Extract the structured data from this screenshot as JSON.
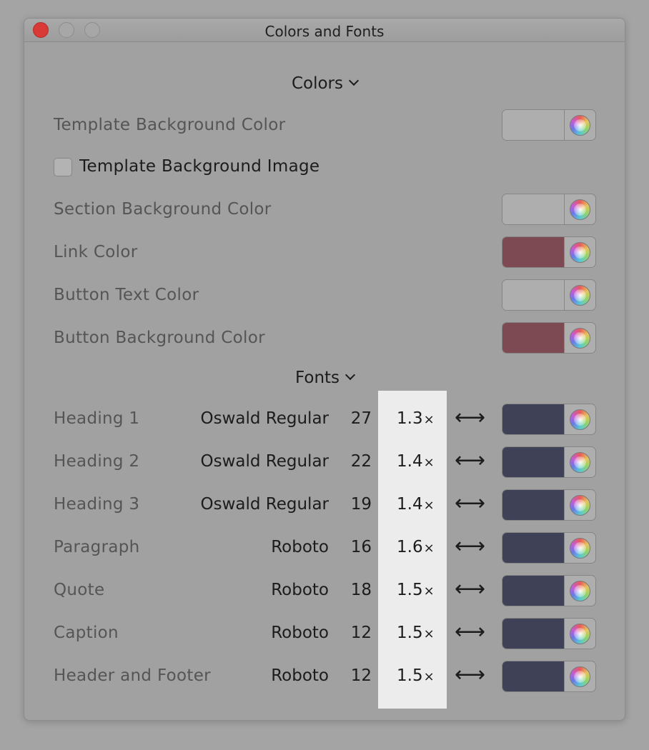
{
  "window": {
    "title": "Colors and Fonts"
  },
  "colors": {
    "header": "Colors",
    "rows": [
      {
        "label": "Template Background Color",
        "swatch": "#aeaeae"
      },
      {
        "label": "Section Background Color",
        "swatch": "#aeaeae"
      },
      {
        "label": "Link Color",
        "swatch": "#7d4953"
      },
      {
        "label": "Button Text Color",
        "swatch": "#aeaeae"
      },
      {
        "label": "Button Background Color",
        "swatch": "#7d4953"
      }
    ],
    "checkbox": {
      "label": "Template Background Image",
      "checked": false
    }
  },
  "fonts": {
    "header": "Fonts",
    "link_symbol": "⟷",
    "rows": [
      {
        "label": "Heading 1",
        "font": "Oswald Regular",
        "size": "27",
        "line_height": "1.3",
        "swatch": "#3f4157"
      },
      {
        "label": "Heading 2",
        "font": "Oswald Regular",
        "size": "22",
        "line_height": "1.4",
        "swatch": "#3f4157"
      },
      {
        "label": "Heading 3",
        "font": "Oswald Regular",
        "size": "19",
        "line_height": "1.4",
        "swatch": "#3f4157"
      },
      {
        "label": "Paragraph",
        "font": "Roboto",
        "size": "16",
        "line_height": "1.6",
        "swatch": "#3f4157"
      },
      {
        "label": "Quote",
        "font": "Roboto",
        "size": "18",
        "line_height": "1.5",
        "swatch": "#3f4157"
      },
      {
        "label": "Caption",
        "font": "Roboto",
        "size": "12",
        "line_height": "1.5",
        "swatch": "#3f4157"
      },
      {
        "label": "Header and Footer",
        "font": "Roboto",
        "size": "12",
        "line_height": "1.5",
        "swatch": "#3f4157"
      }
    ],
    "multiplier_symbol": "×"
  },
  "icons": {
    "color_picker": "color-wheel-icon",
    "disclosure": "chevron-down-icon",
    "link": "double-arrow-icon"
  }
}
